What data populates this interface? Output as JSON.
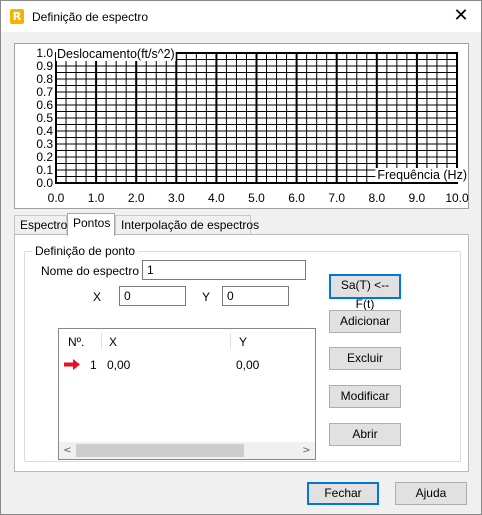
{
  "window": {
    "title": "Definição de espectro",
    "app_icon_letter": "R",
    "close_glyph": "✕"
  },
  "chart_data": {
    "type": "line",
    "ylabel": "Deslocamento(ft/s^2)",
    "xlabel": "Frequência (Hz)",
    "xlim": [
      0.0,
      10.0
    ],
    "ylim": [
      0.0,
      1.0
    ],
    "x_ticks": [
      "0.0",
      "1.0",
      "2.0",
      "3.0",
      "4.0",
      "5.0",
      "6.0",
      "7.0",
      "8.0",
      "9.0",
      "10.0"
    ],
    "y_ticks": [
      "0.0",
      "0.1",
      "0.2",
      "0.3",
      "0.4",
      "0.5",
      "0.6",
      "0.7",
      "0.8",
      "0.9",
      "1.0"
    ],
    "grid": true,
    "series": []
  },
  "tabs": [
    {
      "label": "Espectro",
      "active": false
    },
    {
      "label": "Pontos",
      "active": true
    },
    {
      "label": "Interpolação de espectros",
      "active": false
    }
  ],
  "point_definition": {
    "group_label": "Definição de ponto",
    "spectrum_name_label": "Nome do espectro",
    "spectrum_name_value": "1",
    "x_label": "X",
    "x_value": "0",
    "y_label": "Y",
    "y_value": "0"
  },
  "points_list": {
    "headers": {
      "number": "Nº.",
      "x": "X",
      "y": "Y"
    },
    "rows": [
      {
        "number": "1",
        "x": "0,00",
        "y": "0,00",
        "selected_marker": "red-arrow"
      }
    ],
    "scroll_left": "<",
    "scroll_right": ">"
  },
  "buttons": {
    "convert": "Sa(T) <-- F(t)",
    "add": "Adicionar",
    "delete": "Excluir",
    "modify": "Modificar",
    "open": "Abrir",
    "close": "Fechar",
    "help": "Ajuda"
  },
  "colors": {
    "accent": "#0078d7",
    "marker": "#e81123",
    "grid": "#000000"
  }
}
